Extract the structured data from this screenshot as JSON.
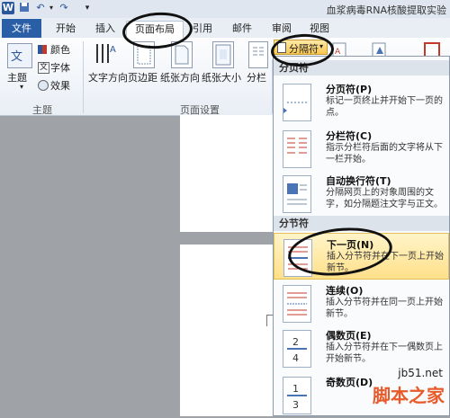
{
  "window": {
    "title": "血浆病毒RNA核酸提取实验"
  },
  "tabs": [
    {
      "label": "文件"
    },
    {
      "label": "开始"
    },
    {
      "label": "插入"
    },
    {
      "label": "页面布局"
    },
    {
      "label": "引用"
    },
    {
      "label": "邮件"
    },
    {
      "label": "审阅"
    },
    {
      "label": "视图"
    }
  ],
  "ribbon": {
    "theme": {
      "label": "主题",
      "colors": "颜色",
      "fonts": "字体",
      "effects": "效果",
      "group": "主题"
    },
    "page_setup": {
      "text_direction": "文字方向",
      "margins": "页边距",
      "orientation": "纸张方向",
      "size": "纸张大小",
      "columns": "分栏",
      "breaks": "分隔符",
      "group": "页面设置"
    }
  },
  "menu": {
    "page_breaks_header": "分页符",
    "section_breaks_header": "分节符",
    "items": [
      {
        "title": "分页符(P)",
        "desc": "标记一页终止并开始下一页的点。"
      },
      {
        "title": "分栏符(C)",
        "desc": "指示分栏符后面的文字将从下一栏开始。"
      },
      {
        "title": "自动换行符(T)",
        "desc": "分隔网页上的对象周围的文字，如分隔题注文字与正文。"
      },
      {
        "title": "下一页(N)",
        "desc": "插入分节符并在下一页上开始新节。"
      },
      {
        "title": "连续(O)",
        "desc": "插入分节符并在同一页上开始新节。"
      },
      {
        "title": "偶数页(E)",
        "desc": "插入分节符并在下一偶数页上开始新节。"
      },
      {
        "title": "奇数页(D)",
        "desc": ""
      }
    ]
  },
  "watermark": {
    "site": "jb51.net",
    "name": "脚本之家"
  },
  "colors": {
    "file_tab": "#2a5ea7",
    "highlight": "#ffe08a",
    "brand": "#e85a2a"
  }
}
